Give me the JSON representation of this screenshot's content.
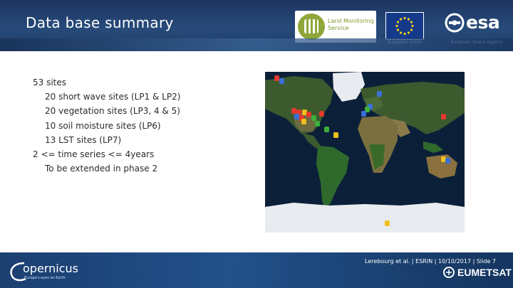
{
  "slide": {
    "title": "Data base summary"
  },
  "logos": {
    "land_monitoring": "Land Monitoring\nService",
    "eu_label": "European Union",
    "esa_text": "esa",
    "esa_label": "European Space Agency",
    "copernicus_text": "opernicus",
    "copernicus_c": "C",
    "copernicus_sub": "Europe's eyes on Earth",
    "eumetsat_text": "EUMETSAT"
  },
  "content": {
    "lines": [
      "53 sites",
      "20 short wave sites (LP1 & LP2)",
      "20 vegetation sites (LP3, 4 & 5)",
      "10 soil moisture sites (LP6)",
      "13 LST sites  (LP7)",
      "2 <= time series <= 4years",
      "To be extended in phase 2"
    ]
  },
  "map": {
    "marker_colors": {
      "red": "#e23a2c",
      "blue": "#3a6fd8",
      "green": "#3cae3a",
      "yellow": "#f0c020"
    }
  },
  "footer": {
    "credit": "Lerebourg et al. | ESRIN | 10/10/2017 | Slide 7"
  },
  "colors": {
    "header_bg": "#23426f",
    "footer_bg": "#1d4678",
    "ocean": "#0b2038",
    "land": "#3c5a2e",
    "ice": "#e8ecf0"
  }
}
